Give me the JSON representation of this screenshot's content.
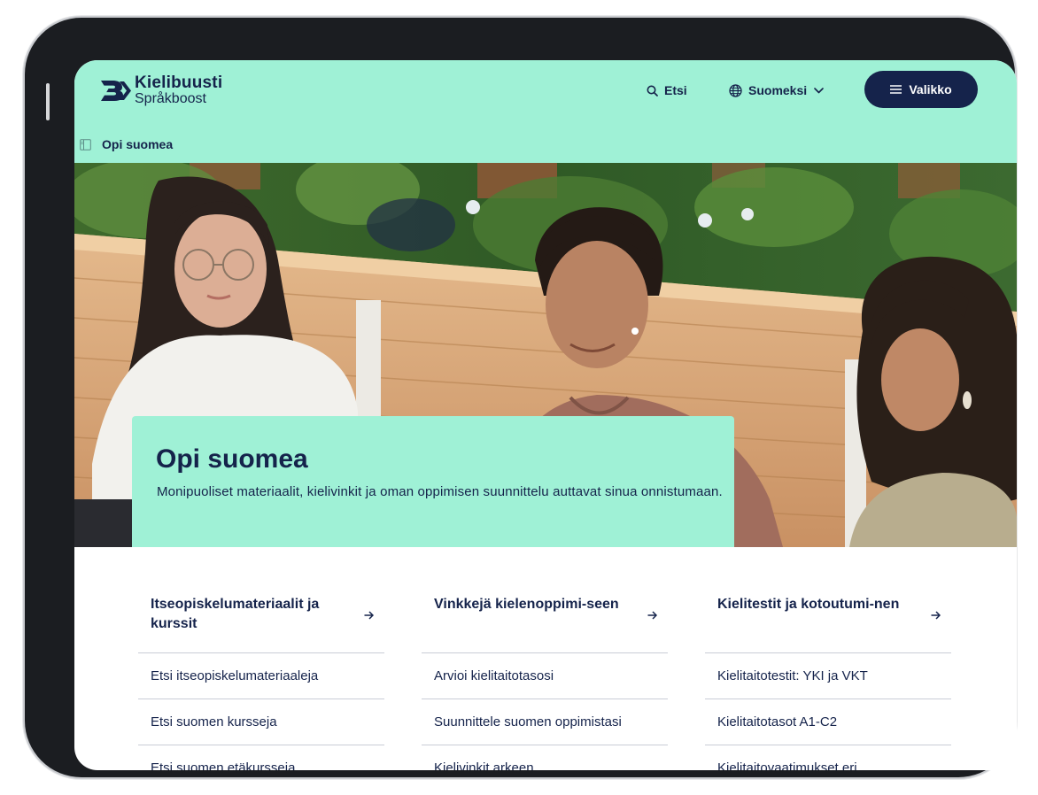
{
  "header": {
    "logo": {
      "line1": "Kielibuusti",
      "line2": "Språkboost"
    },
    "search_label": "Etsi",
    "language_label": "Suomeksi",
    "menu_label": "Valikko",
    "breadcrumb": "Opi suomea"
  },
  "hero": {
    "title": "Opi suomea",
    "description": "Monipuoliset materiaalit, kielivinkit ja oman oppimisen suunnittelu auttavat sinua onnistumaan."
  },
  "columns": [
    {
      "title": "Itseopiskelumateriaalit ja kurssit",
      "links": [
        "Etsi itseopiskelumateriaaleja",
        "Etsi suomen kursseja",
        "Etsi suomen etäkursseja"
      ]
    },
    {
      "title": "Vinkkejä kielenoppimi-seen",
      "links": [
        "Arvioi kielitaitotasosi",
        "Suunnittele suomen oppimistasi",
        "Kielivinkit arkeen"
      ]
    },
    {
      "title": "Kielitestit ja kotoutumi-nen",
      "links": [
        "Kielitaitotestit: YKI ja VKT",
        "Kielitaitotasot A1-C2",
        "Kielitaitovaatimukset eri"
      ]
    }
  ],
  "colors": {
    "mint": "#9ff1d6",
    "navy": "#15234b",
    "divider": "#c9ccd6"
  },
  "icons": {
    "logo": "kielibuusti-logo-icon",
    "search": "search-icon",
    "language": "globe-icon",
    "dropdown": "chevron-down-icon",
    "menu": "hamburger-icon",
    "breadcrumb": "sidebar-panel-icon",
    "link": "arrow-right-icon"
  }
}
